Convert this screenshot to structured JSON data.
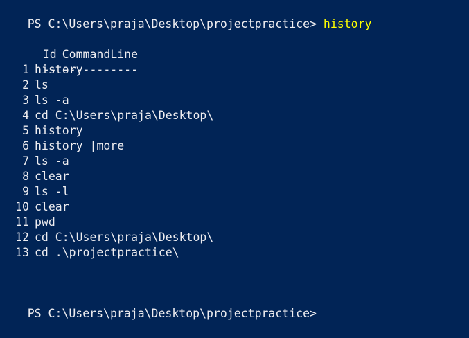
{
  "terminal": {
    "prompt1": "PS C:\\Users\\praja\\Desktop\\projectpractice> ",
    "command1": "history",
    "header": {
      "id": "Id",
      "command": "CommandLine"
    },
    "separator": {
      "id": "--",
      "command": "-----------"
    },
    "rows": [
      {
        "id": "1",
        "command": "history"
      },
      {
        "id": "2",
        "command": "ls"
      },
      {
        "id": "3",
        "command": "ls -a"
      },
      {
        "id": "4",
        "command": "cd C:\\Users\\praja\\Desktop\\"
      },
      {
        "id": "5",
        "command": "history"
      },
      {
        "id": "6",
        "command": "history |more"
      },
      {
        "id": "7",
        "command": "ls -a"
      },
      {
        "id": "8",
        "command": "clear"
      },
      {
        "id": "9",
        "command": "ls -l"
      },
      {
        "id": "10",
        "command": "clear"
      },
      {
        "id": "11",
        "command": "pwd"
      },
      {
        "id": "12",
        "command": "cd C:\\Users\\praja\\Desktop\\"
      },
      {
        "id": "13",
        "command": "cd .\\projectpractice\\"
      }
    ],
    "prompt2": "PS C:\\Users\\praja\\Desktop\\projectpractice>"
  },
  "colors": {
    "background": "#012456",
    "text": "#eeedf0",
    "command": "#ffff00"
  }
}
